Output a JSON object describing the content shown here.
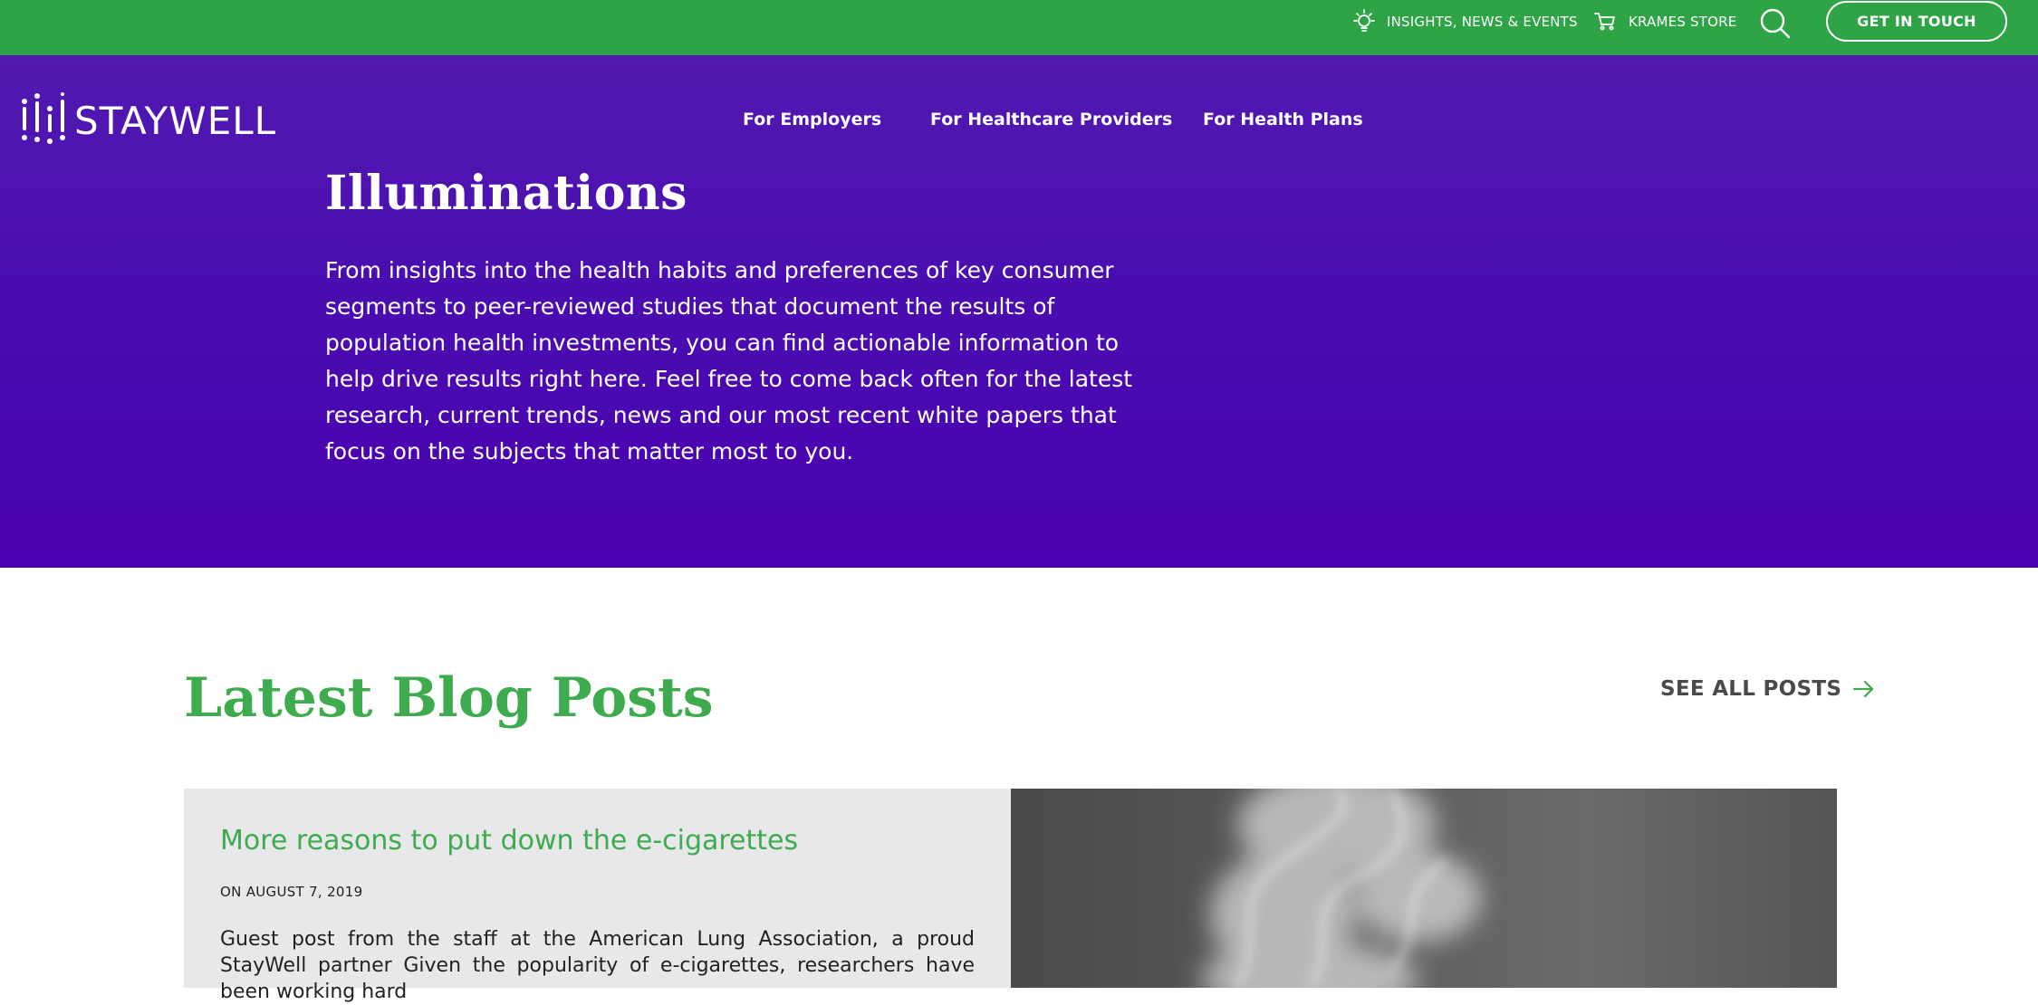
{
  "topbar": {
    "insights_label": "INSIGHTS, NEWS & EVENTS",
    "insights_icon": "lightbulb-icon",
    "store_label": "KRAMES STORE",
    "store_icon": "cart-icon",
    "search_icon": "search-icon",
    "cta_label": "GET IN TOUCH",
    "bg_color": "#2ea446"
  },
  "header": {
    "logo_text": "STAYWELL",
    "nav": [
      {
        "label": "For Employers"
      },
      {
        "label": "For Healthcare Providers"
      },
      {
        "label": "For Health Plans"
      }
    ]
  },
  "hero": {
    "title": "Illuminations",
    "body": "From insights into the health habits and preferences of key consumer segments to peer-reviewed studies that document the results of population health investments, you can find actionable information to help drive results right here. Feel free to come back often for the latest research, current trends, news and our most recent white papers that focus on the subjects that matter most to you.",
    "bg_color": "#4a00b0"
  },
  "blog": {
    "heading": "Latest Blog Posts",
    "see_all_label": "SEE ALL POSTS",
    "accent_color": "#3eab4f",
    "posts": [
      {
        "title": "More reasons to put down the e-cigarettes",
        "date": "ON AUGUST 7, 2019",
        "excerpt": "Guest post from the staff at the American Lung Association, a proud StayWell partner Given the popularity of e-cigarettes, researchers have been working hard"
      }
    ]
  }
}
